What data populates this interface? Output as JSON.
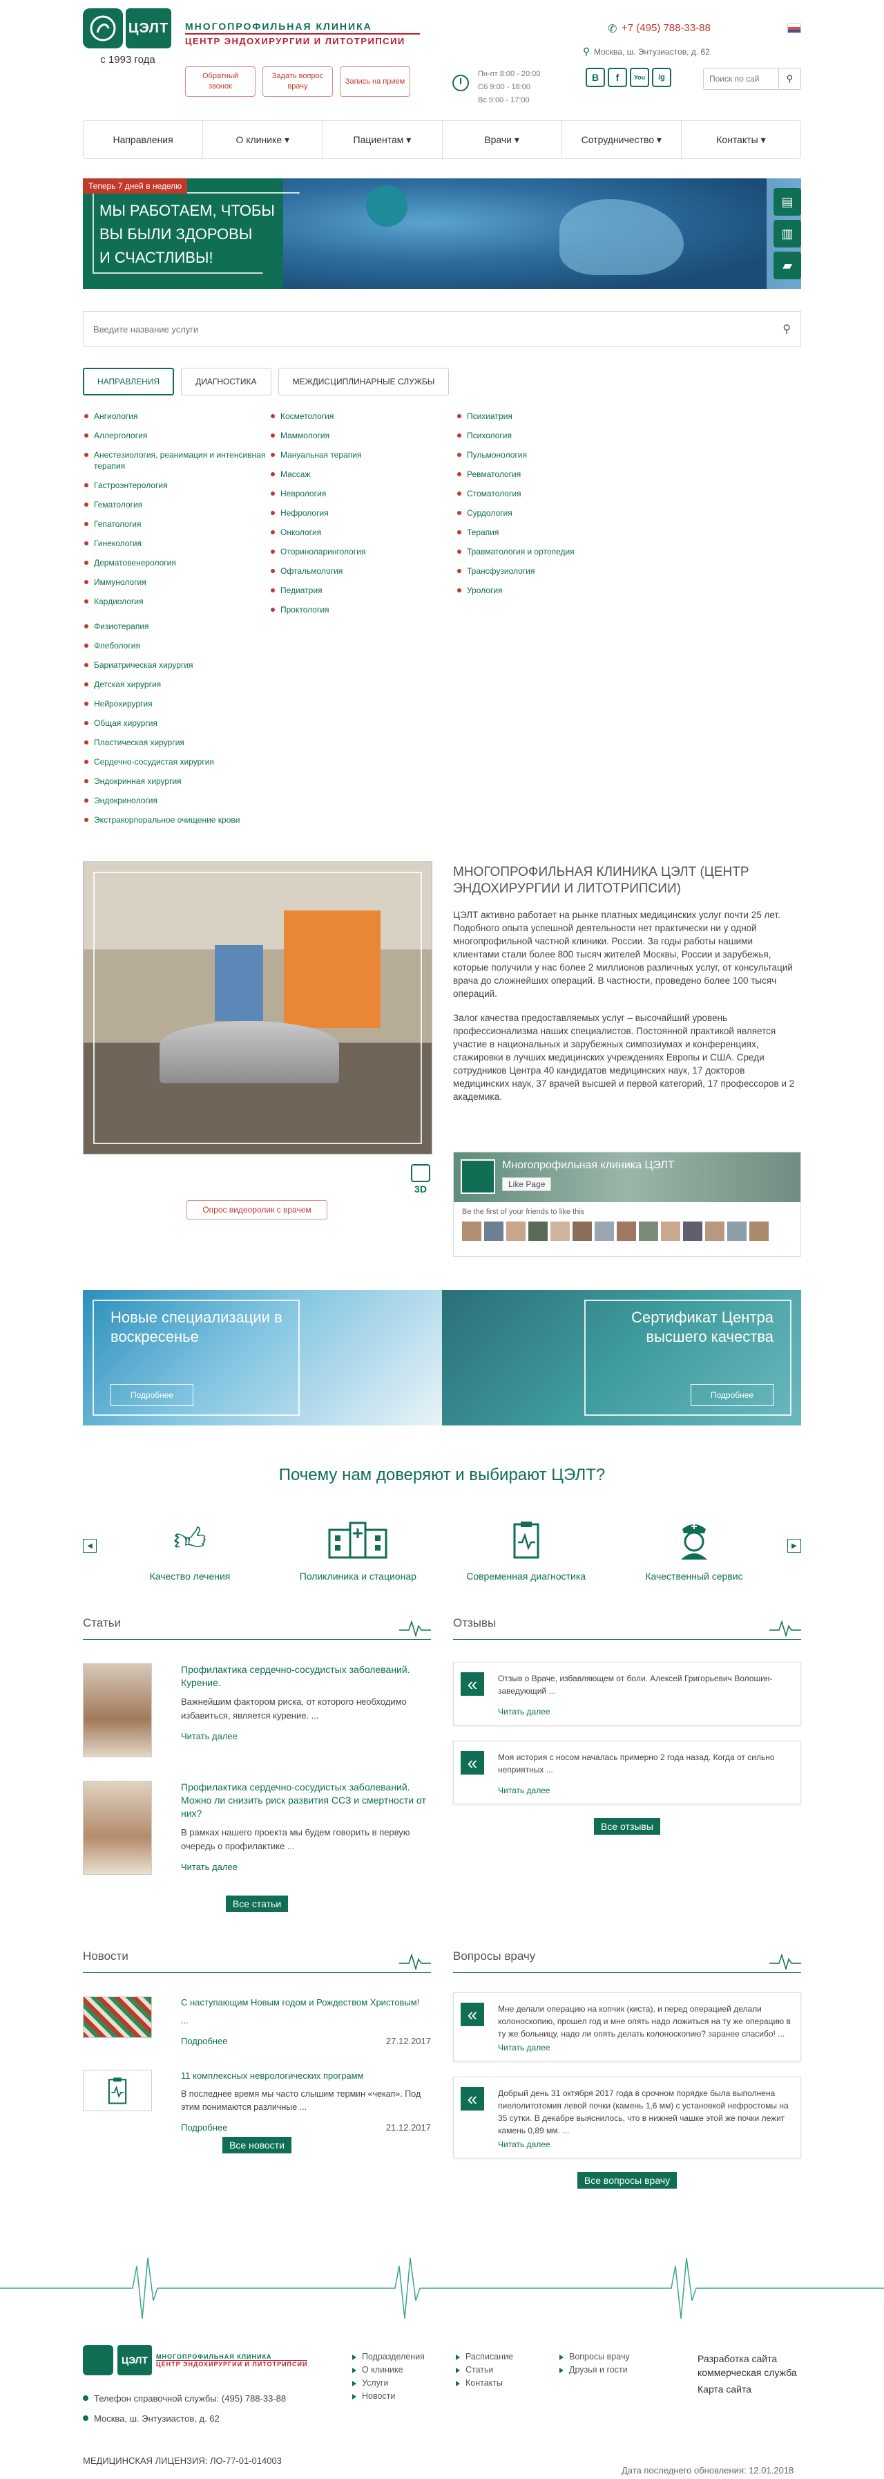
{
  "header": {
    "logo_text": "ЦЭЛТ",
    "since": "с 1993 года",
    "clinic_name_1": "МНОГОПРОФИЛЬНАЯ КЛИНИКА",
    "clinic_name_2": "ЦЕНТР ЭНДОХИРУРГИИ И ЛИТОТРИПСИИ",
    "buttons": [
      "Обратный звонок",
      "Задать вопрос врачу",
      "Запись на прием"
    ],
    "hours": [
      "Пн-пт 8:00 - 20:00",
      "Сб 9:00 - 18:00",
      "Вс 9:00 - 17:00"
    ],
    "phone": "+7 (495) 788-33-88",
    "address": "Москва, ш. Энтузиастов, д. 62",
    "socials": [
      "B",
      "f",
      "You",
      "ig"
    ],
    "search_placeholder": "Поиск по сай"
  },
  "nav": [
    "Направления",
    "О клинике ▾",
    "Пациентам ▾",
    "Врачи ▾",
    "Сотрудничество ▾",
    "Контакты ▾"
  ],
  "banner": {
    "tag": "Теперь 7 дней в неделю",
    "line1": "МЫ РАБОТАЕМ, ЧТОБЫ",
    "line2": "ВЫ БЫЛИ ЗДОРОВЫ",
    "line3": "И СЧАСТЛИВЫ!"
  },
  "services": {
    "search_placeholder": "Введите название услуги",
    "tabs": [
      "НАПРАВЛЕНИЯ",
      "ДИАГНОСТИКА",
      "МЕЖДИСЦИПЛИНАРНЫЕ СЛУЖБЫ"
    ],
    "col1a": [
      "Ангиология",
      "Аллергология",
      "Анестезиология, реанимация и интенсивная терапия",
      "Гастроэнтерология",
      "Гематология",
      "Гепатология",
      "Гинекология",
      "Дерматовенерология",
      "Иммунология",
      "Кардиология"
    ],
    "col1b": [
      "Физиотерапия",
      "Флебология",
      "Бариатрическая хирургия",
      "Детская хирургия",
      "Нейрохирургия",
      "Общая хирургия",
      "Пластическая хирургия",
      "Сердечно-сосудистая хирургия",
      "Эндокринная хирургия",
      "Эндокринология",
      "Экстракорпоральное очищение крови"
    ],
    "col2": [
      "Косметология",
      "Маммология",
      "Мануальная терапия",
      "Массаж",
      "Неврология",
      "Нефрология",
      "Онкология",
      "Оториноларингология",
      "Офтальмология",
      "Педиатрия",
      "Проктология"
    ],
    "col3": [
      "Психиатрия",
      "Психология",
      "Пульмонология",
      "Ревматология",
      "Стоматология",
      "Сурдология",
      "Терапия",
      "Травматология и ортопедия",
      "Трансфузиология",
      "Урология"
    ]
  },
  "about": {
    "title": "МНОГОПРОФИЛЬНАЯ КЛИНИКА ЦЭЛТ (ЦЕНТР ЭНДОХИРУРГИИ И ЛИТОТРИПСИИ)",
    "p1": "ЦЭЛТ активно работает на рынке платных медицинских услуг почти 25 лет. Подобного опыта успешной деятельности нет практически ни у одной многопрофильной частной клиники. России. За годы работы нашими клиентами стали более 800 тысяч жителей Москвы, России и зарубежья, которые получили у нас более 2 миллионов различных услуг, от консультаций врача до сложнейших операций. В частности, проведено более 100 тысяч операций.",
    "p2": "Залог качества предоставляемых услуг – высочайший уровень профессионализма наших специалистов. Постоянной практикой является участие в национальных и зарубежных симпозиумах и конференциях, стажировки в лучших медицинских учреждениях Европы и США. Среди сотрудников Центра 40 кандидатов медицинских наук, 17 докторов медицинских наук, 37 врачей высшей и первой категорий, 17 профессоров и 2 академика.",
    "video_btn": "Опрос видеоролик с врачем",
    "label_3d": "3D",
    "fb_name": "Многопрофильная клиника ЦЭЛТ",
    "fb_like": "Like Page",
    "fb_friends": "Be the first of your friends to like this"
  },
  "promos": [
    {
      "title": "Новые специализации в воскресенье",
      "btn": "Подробнее"
    },
    {
      "title": "Сертификат Центра высшего качества",
      "btn": "Подробнее"
    }
  ],
  "why": {
    "title": "Почему нам доверяют и выбирают ЦЭЛТ?",
    "items": [
      "Качество лечения",
      "Поликлиника и стационар",
      "Современная диагностика",
      "Качественный сервис"
    ]
  },
  "articles": {
    "heading": "Статьи",
    "items": [
      {
        "title": "Профилактика сердечно-сосудистых заболеваний. Курение.",
        "text": "Важнейшим фактором риска, от которого необходимо избавиться, является курение. ...",
        "more": "Читать далее"
      },
      {
        "title": "Профилактика сердечно-сосудистых заболеваний. Можно ли снизить риск развития ССЗ и смертности от них?",
        "text": "В рамках нашего проекта мы будем говорить в первую очередь о профилактике ...",
        "more": "Читать далее"
      }
    ],
    "all_btn": "Все статьи"
  },
  "reviews": {
    "heading": "Отзывы",
    "items": [
      {
        "text": "Отзыв о Враче, избавляющем от боли. Алексей Григорьевич Волошин- заведующий ...",
        "more": "Читать далее"
      },
      {
        "text": "Моя история с носом началась примерно 2 года назад. Когда от сильно неприятных ...",
        "more": "Читать далее"
      }
    ],
    "all_btn": "Все отзывы"
  },
  "news": {
    "heading": "Новости",
    "items": [
      {
        "title": "С наступающим Новым годом и Рождеством Христовым!",
        "text": "...",
        "more": "Подробнее",
        "date": "27.12.2017"
      },
      {
        "title": "11 комплексных неврологических программ",
        "text": "В последнее время мы часто слышим термин «чекап». Под этим понимаются различные ...",
        "more": "Подробнее",
        "date": "21.12.2017"
      }
    ],
    "all_btn": "Все новости"
  },
  "questions": {
    "heading": "Вопросы врачу",
    "items": [
      {
        "text": "Мне делали операцию на копчик (киста), и перед операцией делали колоноскопию, прошел год и мне опять надо ложиться на ту же операцию в ту же больницу, надо ли опять делать колоноскопию? заранее спасибо! ...",
        "more": "Читать далее"
      },
      {
        "text": "Добрый день 31 октября 2017 года в срочном порядке была выполнена пиелолитотомия левой почки (камень 1,6 мм) с установкой нефростомы на 35 сутки. В декабре выяснилось, что в нижней чашке этой же почки лежит камень 0,89 мм. ...",
        "more": "Читать далее"
      }
    ],
    "all_btn": "Все вопросы врачу"
  },
  "footer": {
    "phone": "Телефон справочной службы: (495) 788-33-88",
    "address": "Москва, ш. Энтузиастов, д. 62",
    "license": "МЕДИЦИНСКАЯ ЛИЦЕНЗИЯ: ЛО-77-01-014003",
    "links1": [
      "Подразделения",
      "О клинике",
      "Услуги",
      "Новости"
    ],
    "links2": [
      "Расписание",
      "Статьи",
      "Контакты"
    ],
    "links3": [
      "Вопросы врачу",
      "Друзья и гости"
    ],
    "dev": "Разработка сайта коммерческая служба",
    "map": "Карта сайта",
    "date": "Дата последнего обновления: 12.01.2018"
  }
}
